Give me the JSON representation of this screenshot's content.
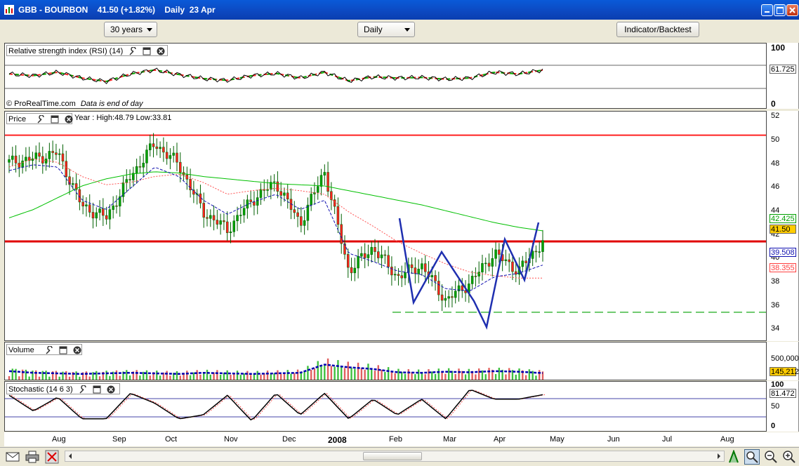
{
  "window": {
    "title": "GBB - BOURBON    41.50 (+1.82%)    Daily  23 Apr",
    "minimize_icon": "minimize-icon",
    "restore_icon": "restore-icon",
    "close_icon": "close-icon"
  },
  "toolbar": {
    "period_select": "30 years",
    "interval_select": "Daily",
    "indicator_button": "Indicator/Backtest"
  },
  "rsi_panel": {
    "label": "Relative strength index (RSI) (14)",
    "ticks": [
      "100",
      "0"
    ],
    "value_tag": "61.725",
    "footer_brand": "© ProRealTime.com",
    "footer_note": "Data is end of day",
    "colors": {
      "rsi": "#000000",
      "signal": "#ff0000",
      "signal2": "#00aa00"
    }
  },
  "price_panel": {
    "label": "Price",
    "year_info": "Year : High:48.79 Low:33.81",
    "ticks": [
      "52",
      "50",
      "48",
      "46",
      "44",
      "42",
      "40",
      "38",
      "36",
      "34"
    ],
    "last_price_tag": "41.50",
    "ma200_tag": "42.425",
    "ma20_tag": "39.508",
    "ma50_tag": "38.355",
    "colors": {
      "resistance": "#ff0000",
      "ma200": "#00c000",
      "ma20": "#0000c0",
      "ma50": "#ff4040",
      "pattern": "#1f2fb0",
      "support": "#00a000",
      "up": "#00a000",
      "down": "#ff2020"
    }
  },
  "volume_panel": {
    "label": "Volume",
    "ticks": [
      "500,000"
    ],
    "value_tag": "145,212"
  },
  "stochastic_panel": {
    "label": "Stochastic (14 6 3)",
    "ticks": [
      "100",
      "50",
      "0"
    ],
    "value_tag": "81.472"
  },
  "x_axis": {
    "labels": [
      "Aug",
      "Sep",
      "Oct",
      "Nov",
      "Dec",
      "2008",
      "Feb",
      "Mar",
      "Apr",
      "May",
      "Jun",
      "Jul",
      "Aug"
    ]
  },
  "chart_data": {
    "type": "line",
    "title": "GBB - BOURBON",
    "price_levels": {
      "resistance": 50.5,
      "neckline": 41.5,
      "support": 35.5
    },
    "last_price": 41.5,
    "change": "+1.82%",
    "year_high": 48.79,
    "year_low": 33.81,
    "x": [
      "Aug",
      "Sep",
      "Oct",
      "Nov",
      "Dec",
      "2008",
      "Feb",
      "Mar",
      "Apr"
    ],
    "series": [
      {
        "name": "Price",
        "values": [
          48.2,
          48.5,
          49.0,
          44.5,
          43.5,
          47.0,
          49.8,
          48.0,
          44.0,
          42.5,
          45.0,
          46.5,
          43.0,
          47.5,
          39.0,
          41.0,
          38.5,
          39.5,
          36.5,
          38.0,
          40.5,
          39.0,
          41.5
        ]
      },
      {
        "name": "MA20",
        "values": [
          47.5,
          48.0,
          47.8,
          45.0,
          44.2,
          46.0,
          47.8,
          47.0,
          45.0,
          43.8,
          44.8,
          45.5,
          44.2,
          45.0,
          40.5,
          39.8,
          39.0,
          38.7,
          37.5,
          37.3,
          38.5,
          38.8,
          39.5
        ]
      },
      {
        "name": "MA50",
        "values": [
          47.8,
          48.5,
          48.2,
          47.0,
          46.3,
          46.5,
          47.0,
          47.2,
          46.5,
          45.5,
          45.8,
          46.0,
          45.8,
          45.5,
          44.0,
          42.8,
          41.5,
          40.5,
          39.6,
          38.9,
          38.6,
          38.4,
          38.4
        ]
      },
      {
        "name": "MA200",
        "values": [
          43.5,
          44.2,
          45.2,
          46.2,
          46.8,
          47.2,
          47.4,
          47.3,
          47.0,
          46.8,
          46.6,
          46.4,
          46.3,
          46.2,
          45.8,
          45.4,
          45.0,
          44.6,
          44.1,
          43.6,
          43.1,
          42.7,
          42.4
        ]
      },
      {
        "name": "Volume",
        "values": [
          180000,
          150000,
          140000,
          130000,
          140000,
          150000,
          140000,
          130000,
          150000,
          140000,
          130000,
          140000,
          150000,
          300000,
          250000,
          220000,
          160000,
          150000,
          170000,
          160000,
          180000,
          170000,
          145212
        ]
      },
      {
        "name": "RSI",
        "values": [
          55,
          52,
          58,
          48,
          42,
          55,
          62,
          54,
          47,
          44,
          52,
          56,
          48,
          58,
          43,
          50,
          48,
          49,
          46,
          48,
          58,
          55,
          61.725
        ]
      },
      {
        "name": "Stochastic",
        "values": [
          80,
          40,
          75,
          20,
          20,
          85,
          60,
          20,
          30,
          80,
          15,
          85,
          30,
          85,
          20,
          70,
          30,
          70,
          20,
          95,
          70,
          70,
          81.472
        ]
      }
    ],
    "ylim": [
      33,
      52.5
    ]
  }
}
